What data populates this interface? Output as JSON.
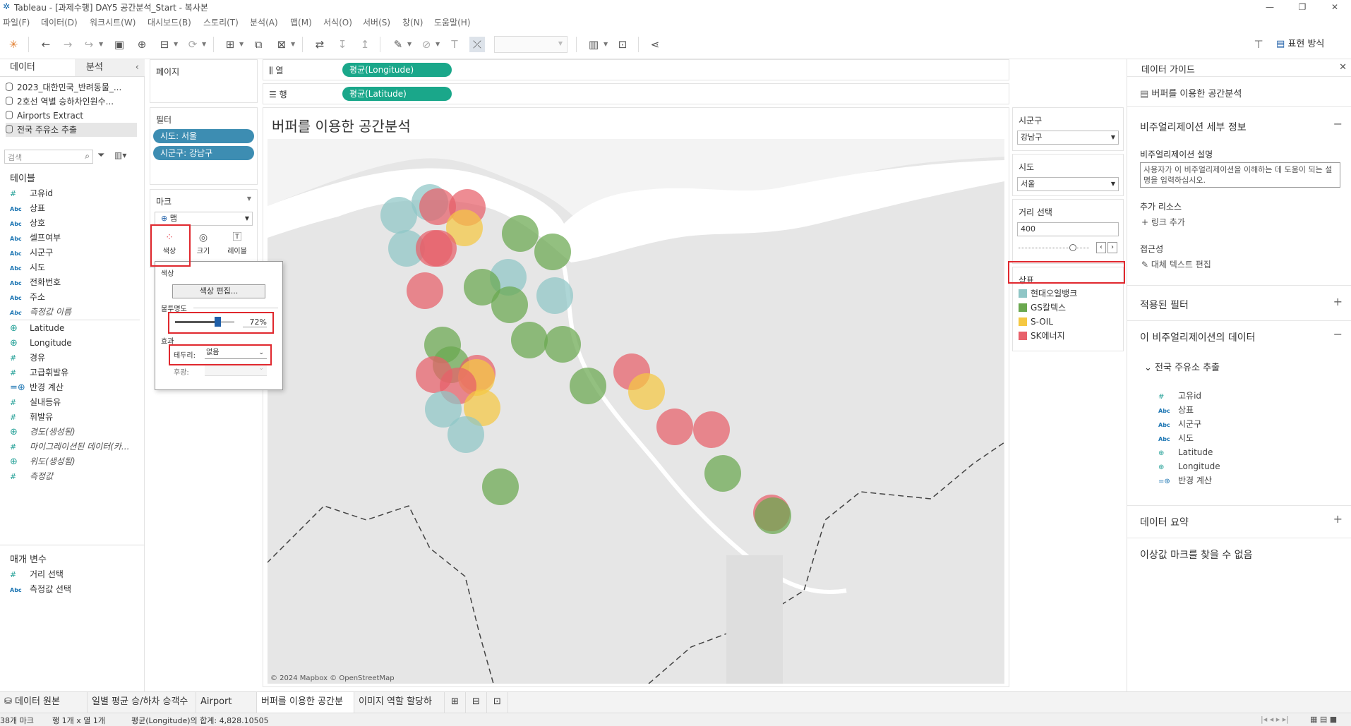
{
  "window": {
    "title": "Tableau - [과제수행] DAY5 공간분석_Start - 복사본"
  },
  "menu": [
    "파일(F)",
    "데이터(D)",
    "워크시트(W)",
    "대시보드(B)",
    "스토리(T)",
    "분석(A)",
    "맵(M)",
    "서식(O)",
    "서버(S)",
    "창(N)",
    "도움말(H)"
  ],
  "toolbar": {
    "show_me_label": "표현 방식"
  },
  "left_pane": {
    "tab_data": "데이터",
    "tab_analysis": "분석",
    "datasources": [
      "2023_대한민국_반려동물_...",
      "2호선 역별 승하차인원수...",
      "Airports Extract",
      "전국 주유소 추출"
    ],
    "search_placeholder": "검색",
    "tables_label": "테이블",
    "fields": [
      {
        "type": "num",
        "name": "고유id"
      },
      {
        "type": "abc",
        "name": "상표"
      },
      {
        "type": "abc",
        "name": "상호"
      },
      {
        "type": "abc",
        "name": "셀프여부"
      },
      {
        "type": "abc",
        "name": "시군구"
      },
      {
        "type": "abc",
        "name": "시도"
      },
      {
        "type": "abc",
        "name": "전화번호"
      },
      {
        "type": "abc",
        "name": "주소"
      },
      {
        "type": "abc",
        "name": "측정값 이름"
      },
      {
        "type": "geo",
        "name": "Latitude"
      },
      {
        "type": "geo",
        "name": "Longitude"
      },
      {
        "type": "num",
        "name": "경유"
      },
      {
        "type": "num",
        "name": "고급휘발유"
      },
      {
        "type": "calc",
        "name": "반경 계산"
      },
      {
        "type": "num",
        "name": "실내등유"
      },
      {
        "type": "num",
        "name": "휘발유"
      },
      {
        "type": "geo",
        "name": "경도(생성됨)"
      },
      {
        "type": "num",
        "name": "마이그레이션된 데이터(카..."
      },
      {
        "type": "geo",
        "name": "위도(생성됨)"
      },
      {
        "type": "num",
        "name": "측정값"
      }
    ],
    "params_label": "매개 변수",
    "params": [
      {
        "type": "num",
        "name": "거리 선택"
      },
      {
        "type": "abc",
        "name": "측정값 선택"
      }
    ]
  },
  "shelves": {
    "pages_label": "페이지",
    "filters_label": "필터",
    "filters": [
      "시도: 서울",
      "시군구: 강남구"
    ],
    "marks_label": "마크",
    "mark_type": "맵",
    "mark_buttons": [
      "색상",
      "크기",
      "레이블"
    ],
    "columns_label": "열",
    "rows_label": "행",
    "columns_pill": "평균(Longitude)",
    "rows_pill": "평균(Latitude)"
  },
  "color_popup": {
    "section_color": "색상",
    "edit_colors_button": "색상 편집...",
    "opacity_label": "불투명도",
    "opacity_value": "72%",
    "opacity_fraction": 0.72,
    "effects_label": "효과",
    "border_label": "테두리:",
    "border_value": "없음",
    "halo_label": "후광:"
  },
  "viz": {
    "title": "버퍼를 이용한 공간분석",
    "attribution": "© 2024 Mapbox © OpenStreetMap"
  },
  "right_filters": {
    "sigungu_label": "시군구",
    "sigungu_value": "강남구",
    "sido_label": "시도",
    "sido_value": "서울",
    "distance_label": "거리 선택",
    "distance_value": "400",
    "legend_title": "상표",
    "legend": [
      {
        "name": "현대오일뱅크",
        "color": "#8fc6c6"
      },
      {
        "name": "GS칼텍스",
        "color": "#6aa84f"
      },
      {
        "name": "S-OIL",
        "color": "#f5c842"
      },
      {
        "name": "SK에너지",
        "color": "#e8606a"
      }
    ]
  },
  "data_guide": {
    "header": "데이터 가이드",
    "sheet_name": "버퍼를 이용한 공간분석",
    "viz_details": "비주얼리제이션 세부 정보",
    "viz_desc_label": "비주얼리제이션 설명",
    "viz_desc_placeholder": "사용자가 이 비주얼리제이션을 이해하는 데 도움이 되는 설명을 입력하십시오.",
    "extra_resources": "추가 리소스",
    "add_link": "링크 추가",
    "accessibility": "접근성",
    "alt_text": "대체 텍스트 편집",
    "applied_filters": "적용된 필터",
    "data_in_viz": "이 비주얼리제이션의 데이터",
    "datasource": "전국 주유소 추출",
    "fields": [
      {
        "type": "num",
        "name": "고유id"
      },
      {
        "type": "abc",
        "name": "상표"
      },
      {
        "type": "abc",
        "name": "시군구"
      },
      {
        "type": "abc",
        "name": "시도"
      },
      {
        "type": "geo",
        "name": "Latitude"
      },
      {
        "type": "geo",
        "name": "Longitude"
      },
      {
        "type": "calc",
        "name": "반경 계산"
      }
    ],
    "data_summary": "데이터 요약",
    "outliers": "이상값 마크를 찾을 수 없음"
  },
  "bottom_tabs": [
    "데이터 원본",
    "일별 평균 승/하차 승객수",
    "Airport Map",
    "버퍼를 이용한 공간분석",
    "이미지 역할 할당하기"
  ],
  "status": {
    "marks": "38개 마크",
    "rows_cols": "행 1개 x 열 1개",
    "sum": "평균(Longitude)의 합계: 4,828.10505"
  }
}
